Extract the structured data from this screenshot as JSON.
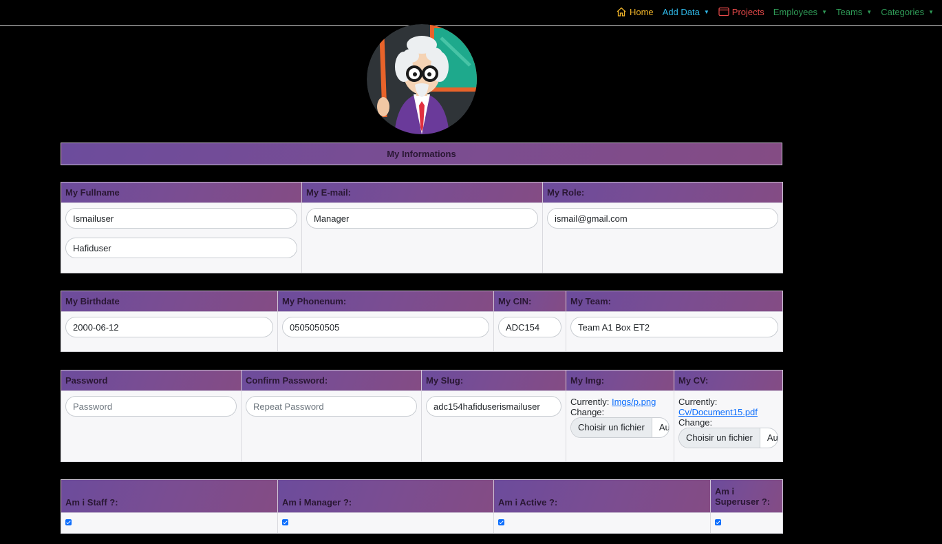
{
  "nav": {
    "home": {
      "label": "Home",
      "color": "#f0b429"
    },
    "add_data": {
      "label": "Add Data",
      "color": "#2fb8e8"
    },
    "projects": {
      "label": "Projects",
      "color": "#e84a4a"
    },
    "employees": {
      "label": "Employees",
      "color": "#2f9b57"
    },
    "teams": {
      "label": "Teams",
      "color": "#2f9b57"
    },
    "categories": {
      "label": "Categories",
      "color": "#2f9b57"
    }
  },
  "banner": {
    "title": "My Informations"
  },
  "section1": {
    "headers": {
      "fullname": "My Fullname",
      "email": "My E-mail:",
      "role": "My Role:"
    },
    "first_name": "Ismailuser",
    "last_name": "Hafiduser",
    "email_value": "Manager",
    "role_value": "ismail@gmail.com"
  },
  "section2": {
    "headers": {
      "birthdate": "My Birthdate",
      "phone": "My Phonenum:",
      "cin": "My CIN:",
      "team": "My Team:"
    },
    "birthdate": "2000-06-12",
    "phone": "0505050505",
    "cin": "ADC154",
    "team": "Team A1 Box ET2"
  },
  "section3": {
    "headers": {
      "password": "Password",
      "confirm": "Confirm Password:",
      "slug": "My Slug:",
      "img": "My Img:",
      "cv": "My CV:"
    },
    "password_placeholder": "Password",
    "confirm_placeholder": "Repeat Password",
    "slug": "adc154hafiduserismailuser",
    "currently_label": "Currently:",
    "change_label": "Change:",
    "img_link": "Imgs/p.png",
    "cv_link": "Cv/Document15.pdf",
    "file_button": "Choisir un fichier",
    "file_text": "Aucun fichier choisi"
  },
  "section4": {
    "headers": {
      "staff": "Am i Staff ?:",
      "manager": "Am i Manager ?:",
      "active": "Am i Active ?:",
      "superuser": "Am i Superuser ?:"
    },
    "staff": true,
    "manager": true,
    "active": true,
    "superuser": true
  }
}
